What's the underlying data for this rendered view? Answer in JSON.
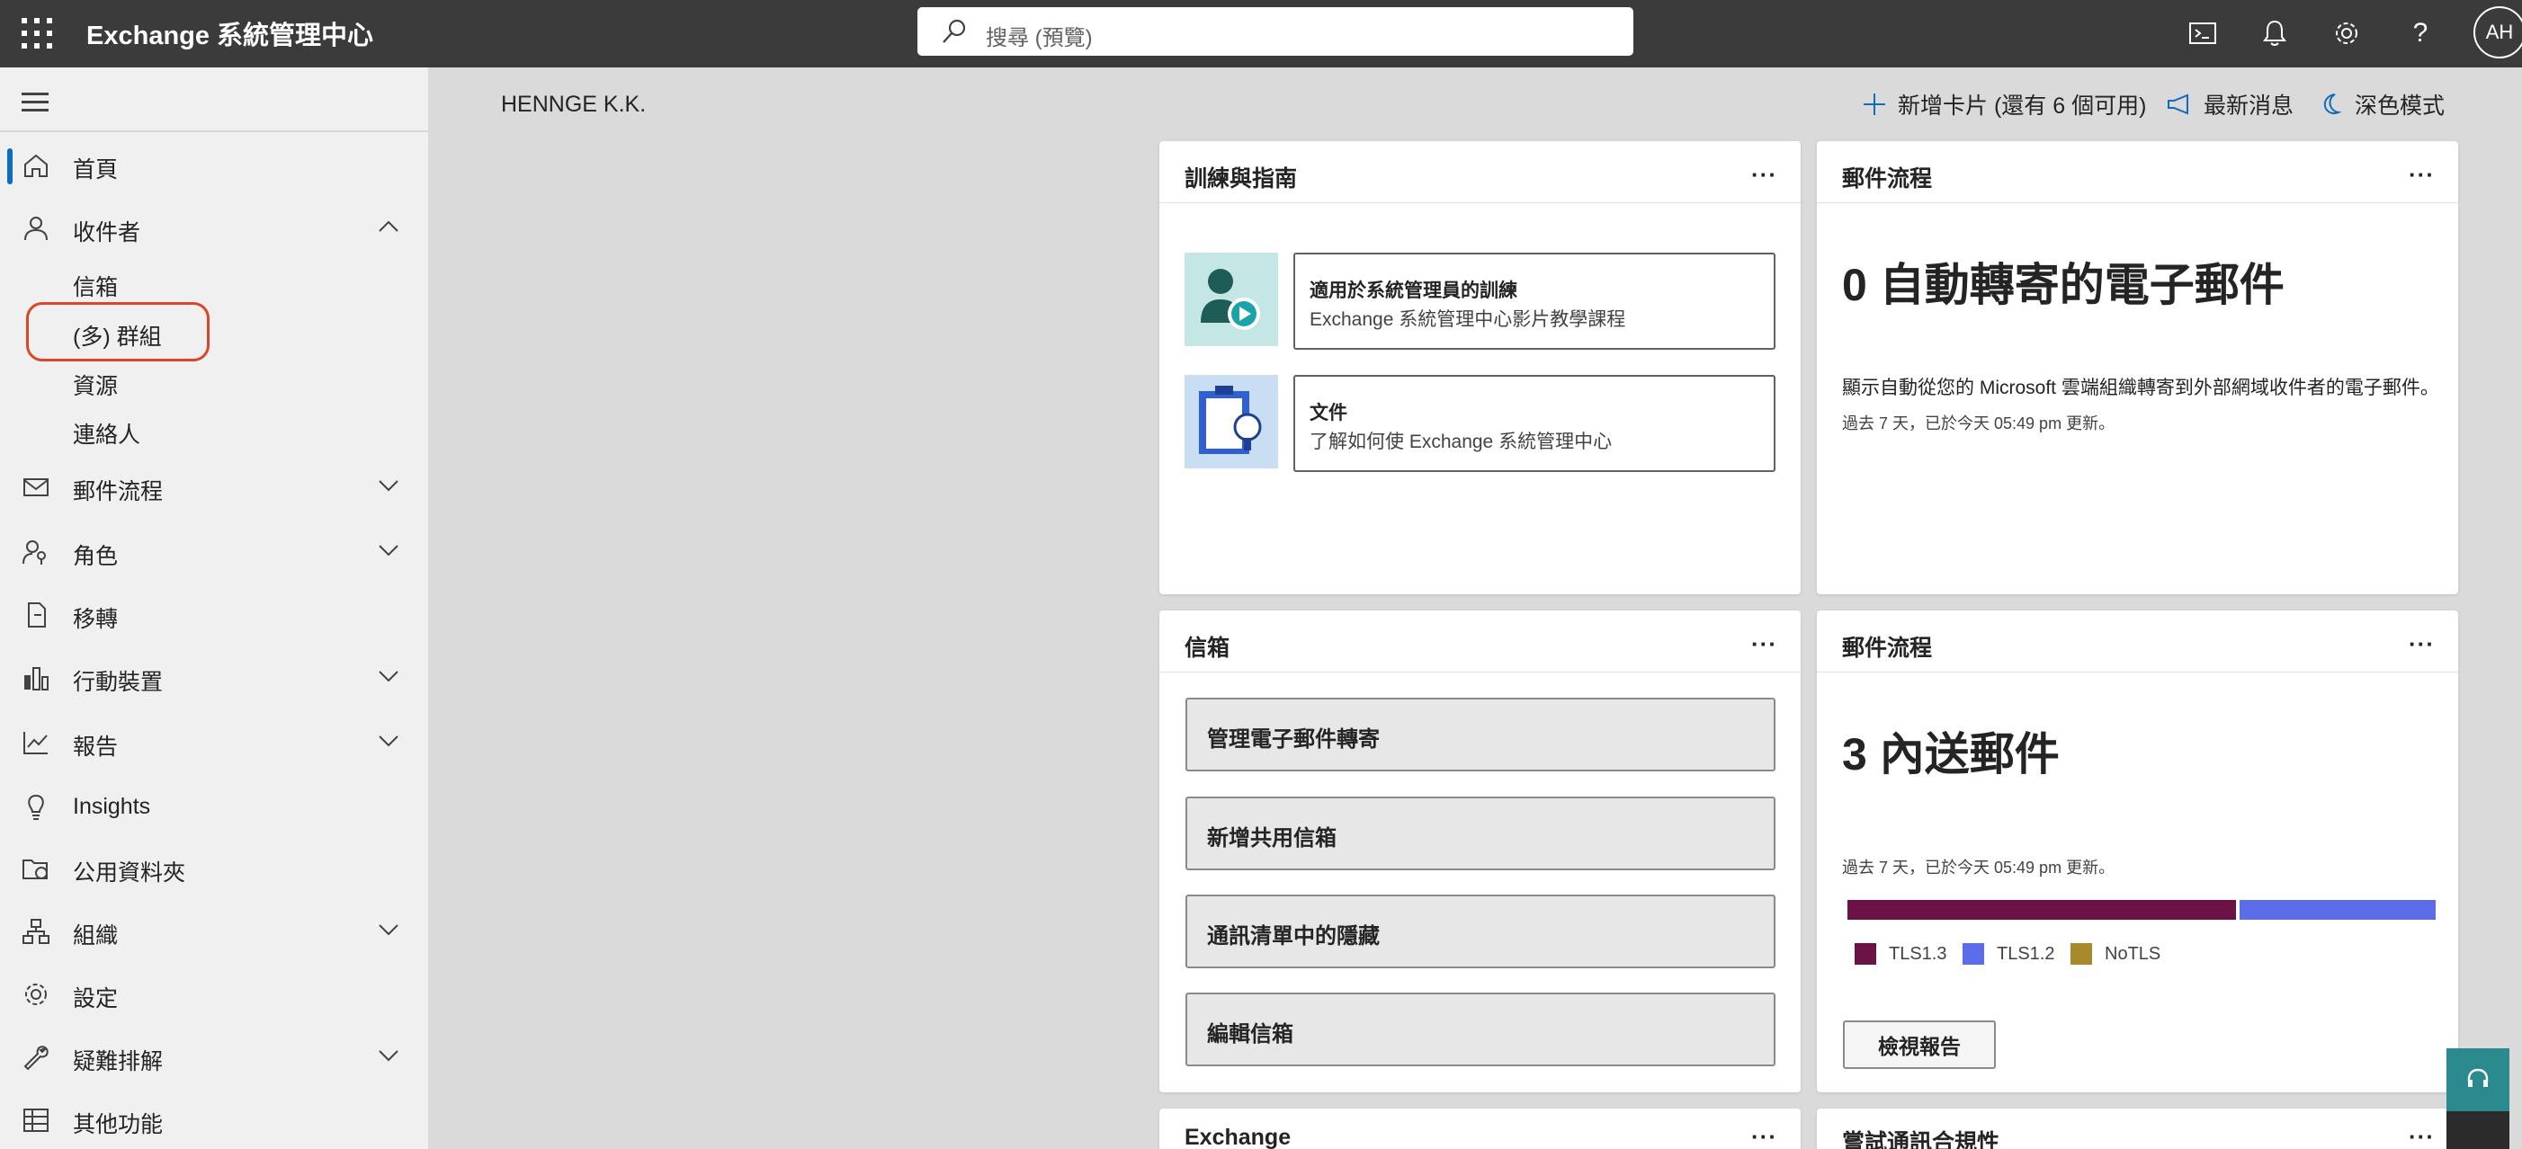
{
  "header": {
    "app_title": "Exchange 系統管理中心",
    "search_placeholder": "搜尋 (預覽)",
    "avatar_initials": "AH",
    "icons": [
      "waffle-icon",
      "search-icon",
      "terminal-icon",
      "bell-icon",
      "gear-icon",
      "help-icon"
    ]
  },
  "sidebar": {
    "items": {
      "home": "首頁",
      "recipients": "收件者",
      "mailboxes": "信箱",
      "groups": "(多) 群組",
      "resources": "資源",
      "contacts": "連絡人",
      "mail_flow": "郵件流程",
      "roles": "角色",
      "migration": "移轉",
      "mobile": "行動裝置",
      "reports": "報告",
      "insights": "Insights",
      "public_folders": "公用資料夾",
      "organization": "組織",
      "settings": "設定",
      "troubleshoot": "疑難排解",
      "other": "其他功能"
    }
  },
  "main": {
    "org_name": "HENNGE K.K.",
    "commands": {
      "add_card": "新增卡片 (還有 6 個可用)",
      "whats_new": "最新消息",
      "dark_mode": "深色模式"
    },
    "more": "···",
    "training_card": {
      "title": "訓練與指南",
      "tile1_title": "適用於系統管理員的訓練",
      "tile1_sub": "Exchange 系統管理中心影片教學課程",
      "tile2_title": "文件",
      "tile2_sub": "了解如何使 Exchange 系統管理中心"
    },
    "forward_card": {
      "title": "郵件流程",
      "metric": "0 自動轉寄的電子郵件",
      "description": "顯示自動從您的 Microsoft 雲端組織轉寄到外部網域收件者的電子郵件。",
      "updated": "過去 7 天，已於今天 05:49 pm 更新。"
    },
    "mailbox_card": {
      "title": "信箱",
      "actions": [
        "管理電子郵件轉寄",
        "新增共用信箱",
        "通訊清單中的隱藏",
        "編輯信箱"
      ]
    },
    "inbound_card": {
      "title": "郵件流程",
      "metric": "3 內送郵件",
      "updated": "過去 7 天，已於今天 05:49 pm 更新。",
      "legend": [
        "TLS1.3",
        "TLS1.2",
        "NoTLS"
      ],
      "colors": {
        "tls13": "#6b1247",
        "tls12": "#5b6de8",
        "notls": "#a8892c"
      },
      "bar_fractions": {
        "tls13": 0.66,
        "tls12": 0.33,
        "notls": 0.0
      },
      "view_report": "檢視報告"
    },
    "bottom_cards": {
      "exchange_title": "Exchange",
      "compliance_title": "嘗試通訊合規性"
    }
  }
}
